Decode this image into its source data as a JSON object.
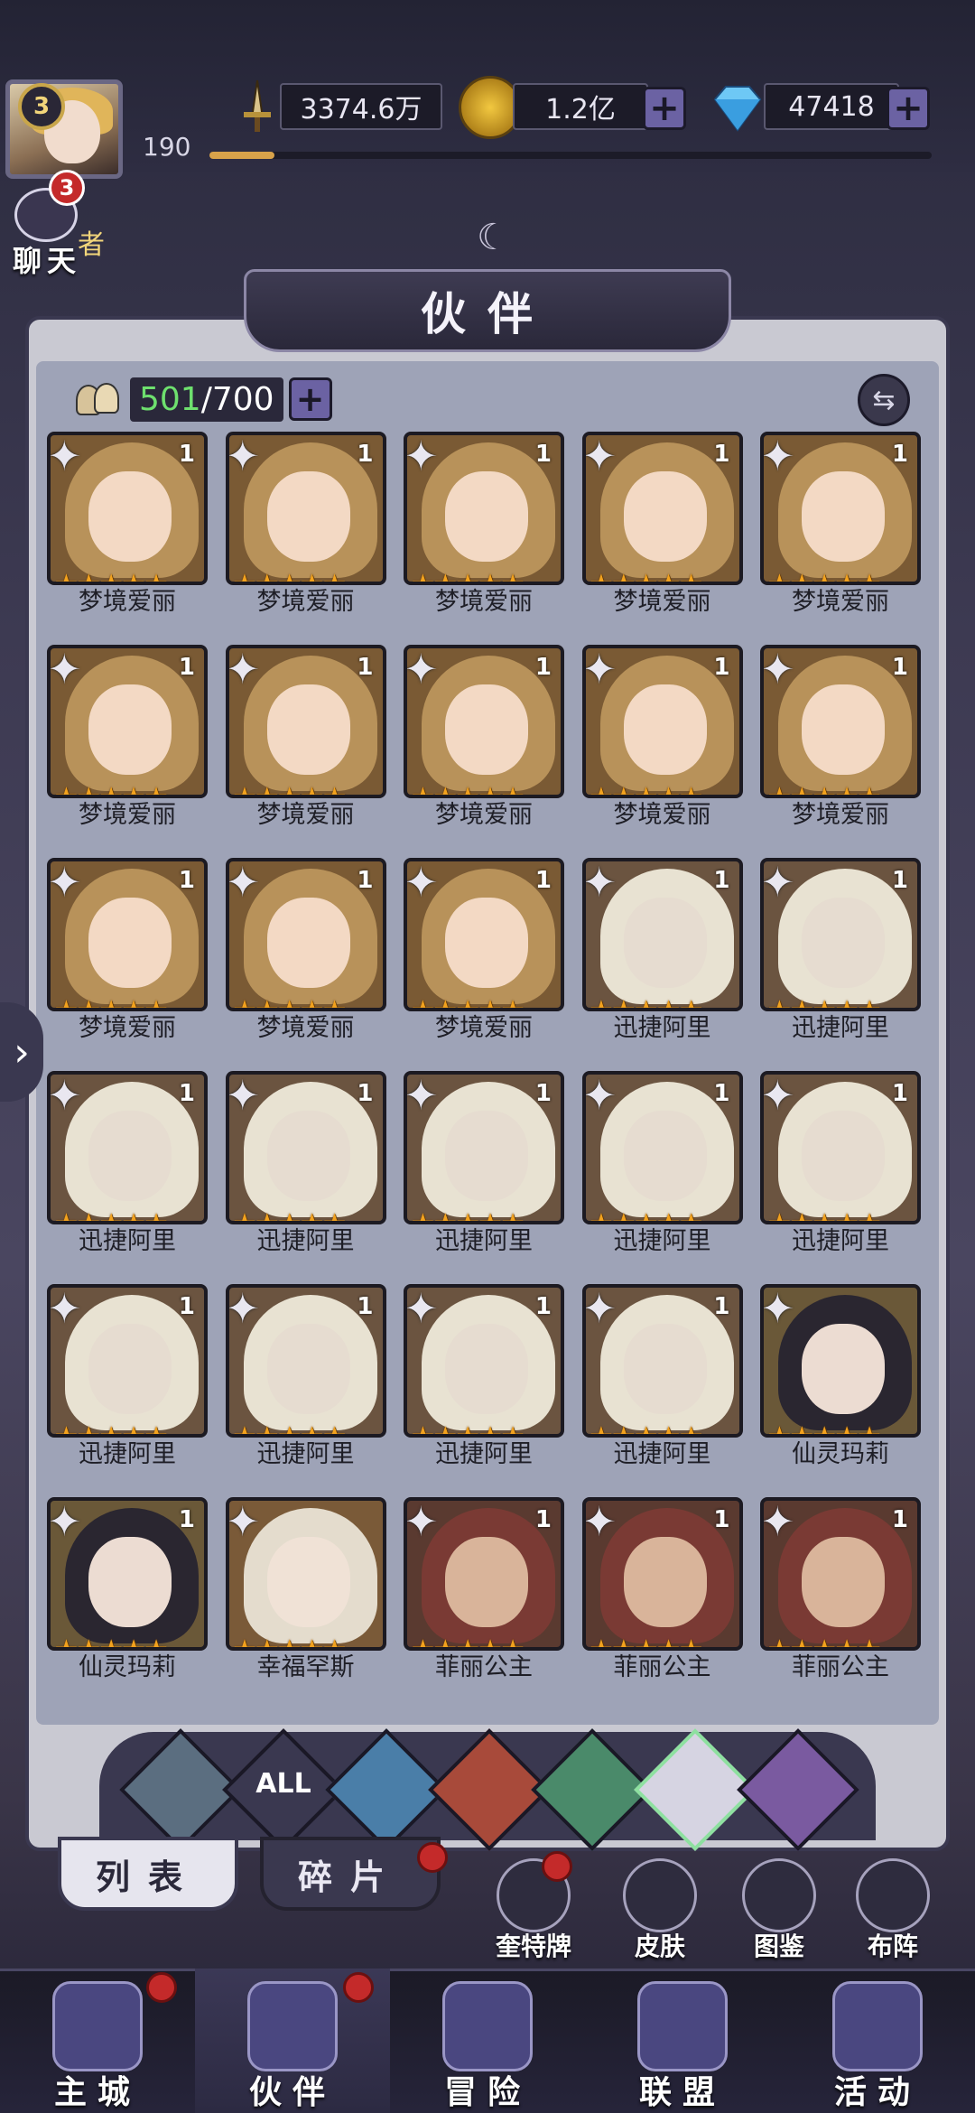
{
  "header": {
    "player_level": "3",
    "player_xp": "190",
    "xp_progress": 0.09,
    "power_value": "3374.6万",
    "gold_value": "1.2亿",
    "gem_value": "47418",
    "chat_badge": "3",
    "chat_label": "聊天",
    "chat_extra": "者"
  },
  "page": {
    "title": "伙伴",
    "count_have": "501",
    "count_sep": "/700"
  },
  "heroes": [
    {
      "name": "梦境爱丽",
      "level": "1",
      "palette": "alice"
    },
    {
      "name": "梦境爱丽",
      "level": "1",
      "palette": "alice"
    },
    {
      "name": "梦境爱丽",
      "level": "1",
      "palette": "alice"
    },
    {
      "name": "梦境爱丽",
      "level": "1",
      "palette": "alice"
    },
    {
      "name": "梦境爱丽",
      "level": "1",
      "palette": "alice"
    },
    {
      "name": "梦境爱丽",
      "level": "1",
      "palette": "alice"
    },
    {
      "name": "梦境爱丽",
      "level": "1",
      "palette": "alice"
    },
    {
      "name": "梦境爱丽",
      "level": "1",
      "palette": "alice"
    },
    {
      "name": "梦境爱丽",
      "level": "1",
      "palette": "alice"
    },
    {
      "name": "梦境爱丽",
      "level": "1",
      "palette": "alice"
    },
    {
      "name": "梦境爱丽",
      "level": "1",
      "palette": "alice"
    },
    {
      "name": "梦境爱丽",
      "level": "1",
      "palette": "alice"
    },
    {
      "name": "梦境爱丽",
      "level": "1",
      "palette": "alice"
    },
    {
      "name": "迅捷阿里",
      "level": "1",
      "palette": "ali"
    },
    {
      "name": "迅捷阿里",
      "level": "1",
      "palette": "ali"
    },
    {
      "name": "迅捷阿里",
      "level": "1",
      "palette": "ali"
    },
    {
      "name": "迅捷阿里",
      "level": "1",
      "palette": "ali"
    },
    {
      "name": "迅捷阿里",
      "level": "1",
      "palette": "ali"
    },
    {
      "name": "迅捷阿里",
      "level": "1",
      "palette": "ali"
    },
    {
      "name": "迅捷阿里",
      "level": "1",
      "palette": "ali"
    },
    {
      "name": "迅捷阿里",
      "level": "1",
      "palette": "ali"
    },
    {
      "name": "迅捷阿里",
      "level": "1",
      "palette": "ali"
    },
    {
      "name": "迅捷阿里",
      "level": "1",
      "palette": "ali"
    },
    {
      "name": "迅捷阿里",
      "level": "1",
      "palette": "ali"
    },
    {
      "name": "仙灵玛莉",
      "level": "",
      "palette": "mary"
    },
    {
      "name": "仙灵玛莉",
      "level": "1",
      "palette": "mary"
    },
    {
      "name": "幸福罕斯",
      "level": "",
      "palette": "hans"
    },
    {
      "name": "菲丽公主",
      "level": "1",
      "palette": "feli"
    },
    {
      "name": "菲丽公主",
      "level": "1",
      "palette": "feli"
    },
    {
      "name": "菲丽公主",
      "level": "1",
      "palette": "feli"
    }
  ],
  "filters": [
    {
      "id": "faction-1",
      "label": ""
    },
    {
      "id": "all",
      "label": "ALL"
    },
    {
      "id": "water",
      "label": ""
    },
    {
      "id": "fire",
      "label": ""
    },
    {
      "id": "wind",
      "label": ""
    },
    {
      "id": "light",
      "label": ""
    },
    {
      "id": "dark",
      "label": ""
    }
  ],
  "sub_tabs": {
    "list": "列表",
    "shards": "碎片"
  },
  "utilities": {
    "cards": "奎特牌",
    "skins": "皮肤",
    "codex": "图鉴",
    "formation": "布阵"
  },
  "nav": {
    "city": "主城",
    "partners": "伙伴",
    "adventure": "冒险",
    "alliance": "联盟",
    "events": "活动"
  },
  "stars": "★★★★★"
}
